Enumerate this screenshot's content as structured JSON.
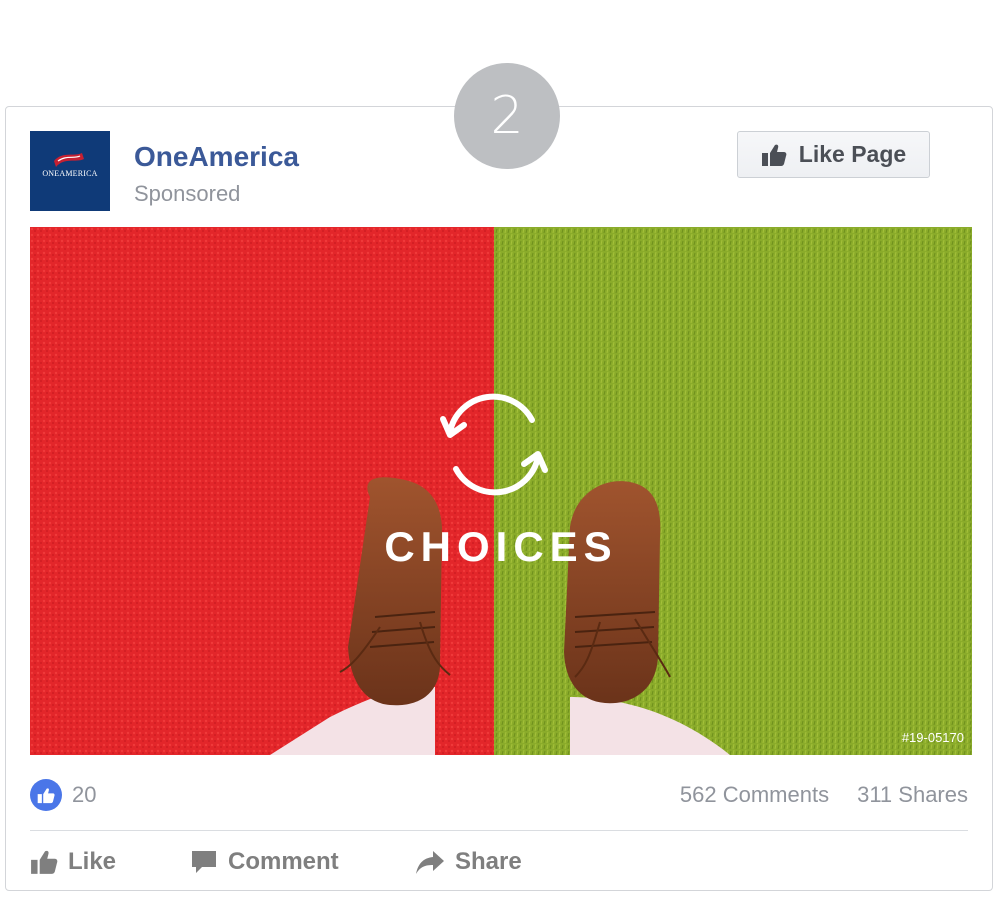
{
  "step_number": "2",
  "post": {
    "page_name": "OneAmerica",
    "sponsored": "Sponsored",
    "logo_text": "ONEAMERICA",
    "like_page_label": "Like Page"
  },
  "media": {
    "headline": "CHOICES",
    "image_code": "#19-05170",
    "icon": "refresh-arrows-icon",
    "colors": {
      "left_carpet": "#e3262a",
      "right_grass": "#8aab2a"
    }
  },
  "stats": {
    "reactions": "20",
    "comments": "562 Comments",
    "shares": "311 Shares"
  },
  "actions": {
    "like": "Like",
    "comment": "Comment",
    "share": "Share"
  },
  "colors": {
    "brand_blue": "#3b5998",
    "logo_bg": "#0f3a78",
    "reaction_blue": "#4a76e8",
    "muted_text": "#90949c"
  }
}
